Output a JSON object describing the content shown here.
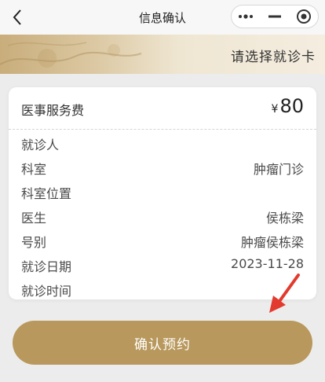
{
  "nav": {
    "title": "信息确认"
  },
  "banner": {
    "select_card_label": "请选择就诊卡"
  },
  "fee": {
    "label": "医事服务费",
    "currency": "¥",
    "amount": "80"
  },
  "info": {
    "rows": [
      {
        "label": "就诊人",
        "value": ""
      },
      {
        "label": "科室",
        "value": "肿瘤门诊"
      },
      {
        "label": "科室位置",
        "value": ""
      },
      {
        "label": "医生",
        "value": "侯栋梁"
      },
      {
        "label": "号别",
        "value": "肿瘤侯栋梁"
      },
      {
        "label": "就诊日期",
        "value": "2023-11-28"
      },
      {
        "label": "就诊时间",
        "value": ""
      }
    ]
  },
  "actions": {
    "confirm_label": "确认预约"
  },
  "colors": {
    "accent": "#b8985c",
    "arrow": "#e23a2e"
  },
  "icons": {
    "back": "chevron-left-icon",
    "more": "more-dots-icon",
    "minimize": "minimize-icon",
    "close": "target-close-icon",
    "annotation": "red-arrow-icon"
  }
}
